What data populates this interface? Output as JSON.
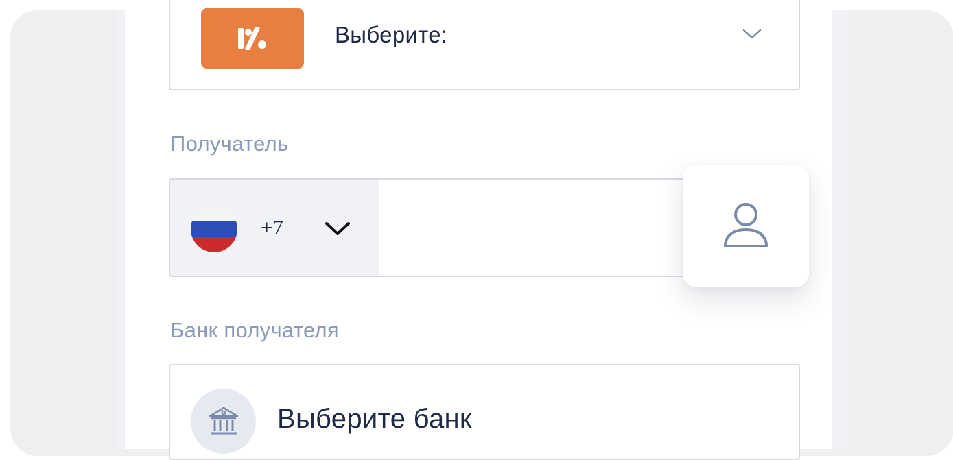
{
  "colors": {
    "accent_orange": "#e87f40",
    "text_primary": "#1f2a44",
    "label_muted": "#8a9bb8",
    "border": "#d6d9e1",
    "icon_muted": "#7b8aa8"
  },
  "program_select": {
    "badge_icon": "percent-logo-icon",
    "label": "Выберите:",
    "chevron_icon": "chevron-down-icon"
  },
  "recipient": {
    "label": "Получатель",
    "country_flag": "russia-flag-icon",
    "country_code": "+7",
    "country_chevron_icon": "chevron-down-icon",
    "phone_value": "",
    "contacts_icon": "person-icon"
  },
  "bank": {
    "label": "Банк получателя",
    "icon": "bank-building-icon",
    "placeholder": "Выберите банк"
  }
}
